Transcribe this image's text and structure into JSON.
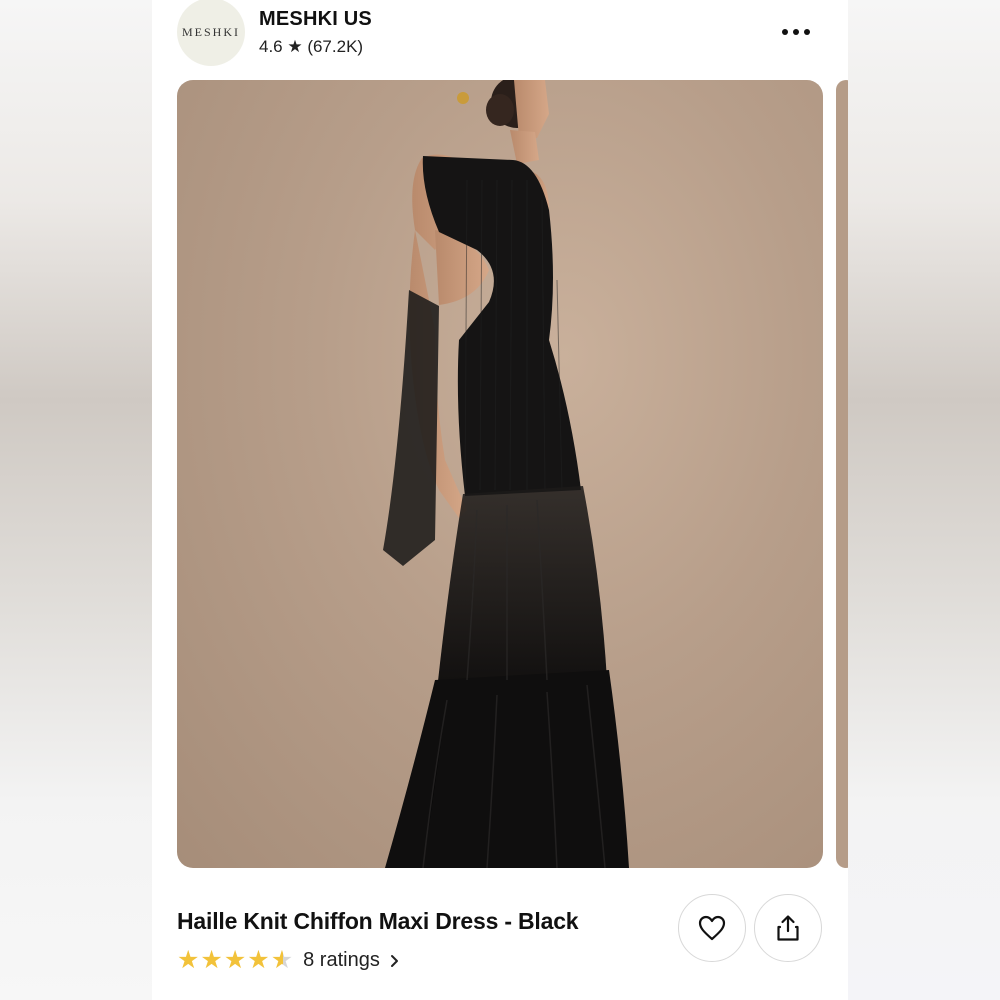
{
  "store": {
    "logo_text": "MESHKI",
    "name": "MESHKI US",
    "rating": "4.6 ★ (67.2K)"
  },
  "product": {
    "image_icon": "product-photo-black-maxi-dress",
    "title": "Haille Knit Chiffon Maxi Dress - Black",
    "star_rating": 4.5,
    "ratings_label": "8 ratings"
  },
  "actions": {
    "more_icon": "more-horizontal-icon",
    "like_icon": "heart-icon",
    "share_icon": "share-icon"
  },
  "colors": {
    "star": "#f2c23a",
    "image_background": "#b79e8a"
  }
}
